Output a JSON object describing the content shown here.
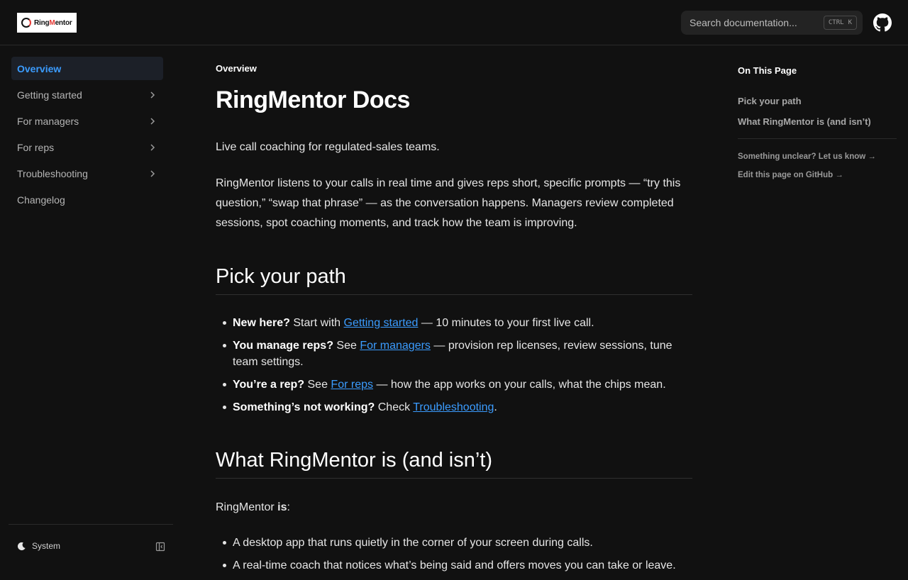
{
  "header": {
    "logo_text_ring": "Ring",
    "logo_text_mentor_m": "M",
    "logo_text_mentor_rest": "entor",
    "search_placeholder": "Search documentation...",
    "search_shortcut_key1": "CTRL",
    "search_shortcut_key2": "K",
    "github_icon": "github-icon"
  },
  "sidebar": {
    "items": [
      {
        "label": "Overview",
        "active": true,
        "has_children": false
      },
      {
        "label": "Getting started",
        "active": false,
        "has_children": true
      },
      {
        "label": "For managers",
        "active": false,
        "has_children": true
      },
      {
        "label": "For reps",
        "active": false,
        "has_children": true
      },
      {
        "label": "Troubleshooting",
        "active": false,
        "has_children": true
      },
      {
        "label": "Changelog",
        "active": false,
        "has_children": false
      }
    ],
    "footer": {
      "theme_label": "System",
      "theme_icon": "moon-icon",
      "collapse_icon": "sidebar-collapse-icon"
    }
  },
  "main": {
    "breadcrumb": "Overview",
    "title": "RingMentor Docs",
    "tagline": "Live call coaching for regulated-sales teams.",
    "intro": "RingMentor listens to your calls in real time and gives reps short, specific prompts — “try this question,” “swap that phrase” — as the conversation happens. Managers review completed sessions, spot coaching moments, and track how the team is improving.",
    "section1": {
      "heading": "Pick your path",
      "items": [
        {
          "bold": "New here?",
          "pre": " Start with ",
          "link": "Getting started",
          "post": " — 10 minutes to your first live call."
        },
        {
          "bold": "You manage reps?",
          "pre": " See ",
          "link": "For managers",
          "post": " — provision rep licenses, review sessions, tune team settings."
        },
        {
          "bold": "You’re a rep?",
          "pre": " See ",
          "link": "For reps",
          "post": " — how the app works on your calls, what the chips mean."
        },
        {
          "bold": "Something’s not working?",
          "pre": " Check ",
          "link": "Troubleshooting",
          "post": "."
        }
      ]
    },
    "section2": {
      "heading": "What RingMentor is (and isn’t)",
      "lead_pre": "RingMentor ",
      "lead_bold": "is",
      "lead_post": ":",
      "items": [
        "A desktop app that runs quietly in the corner of your screen during calls.",
        "A real-time coach that notices what’s being said and offers moves you can take or leave."
      ]
    }
  },
  "toc": {
    "title": "On This Page",
    "links": [
      "Pick your path",
      "What RingMentor is (and isn’t)"
    ],
    "feedback": "Something unclear? Let us know →",
    "edit": "Edit this page on GitHub →"
  }
}
